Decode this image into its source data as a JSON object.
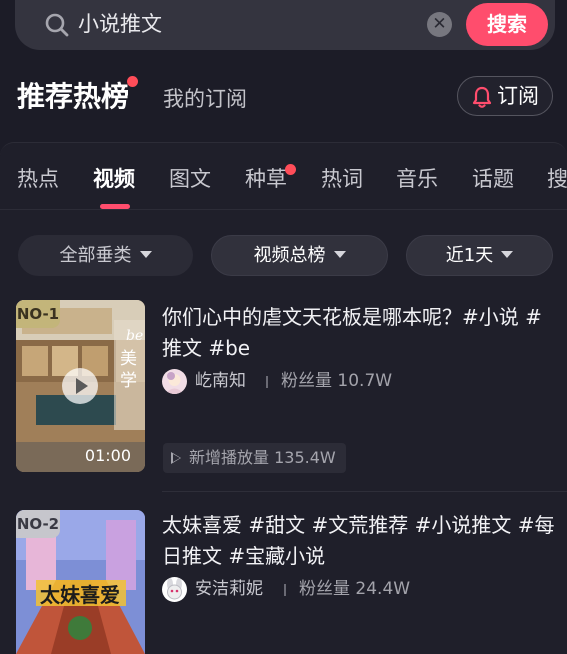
{
  "search": {
    "query": "小说推文",
    "button_label": "搜索"
  },
  "header": {
    "title": "推荐热榜",
    "secondary_tab": "我的订阅",
    "subscribe_label": "订阅"
  },
  "tabs": [
    {
      "label": "热点",
      "active": false
    },
    {
      "label": "视频",
      "active": true
    },
    {
      "label": "图文",
      "active": false
    },
    {
      "label": "种草",
      "active": false,
      "badge_dot": true
    },
    {
      "label": "热词",
      "active": false
    },
    {
      "label": "音乐",
      "active": false
    },
    {
      "label": "话题",
      "active": false
    },
    {
      "label": "搜",
      "active": false
    }
  ],
  "filters": [
    {
      "label": "全部垂类"
    },
    {
      "label": "视频总榜"
    },
    {
      "label": "近1天"
    }
  ],
  "items": [
    {
      "rank": "NO-1",
      "title": "你们心中的虐文天花板是哪本呢？#小说 #推文 #be",
      "duration": "01:00",
      "author": "屹南知",
      "fans_label": "粉丝量",
      "fans": "10.7W",
      "plays_label": "新增播放量",
      "plays": "135.4W",
      "thumb_text": "be美学"
    },
    {
      "rank": "NO-2",
      "title": "太妹喜爱 #甜文 #文荒推荐 #小说推文 #每日推文 #宝藏小说",
      "author": "安洁莉妮",
      "fans_label": "粉丝量",
      "fans": "24.4W",
      "thumb_text": "太妹喜爱"
    }
  ],
  "colors": {
    "accent": "#ff4d6d",
    "background": "#1c1c27",
    "panel": "#1f1f2a"
  }
}
